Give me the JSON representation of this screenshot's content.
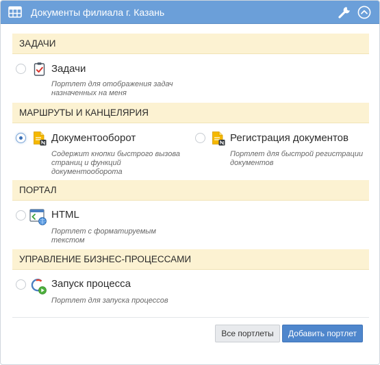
{
  "dialog": {
    "title": "Документы филиала г. Казань"
  },
  "sections": [
    {
      "title": "ЗАДАЧИ",
      "portlets": [
        {
          "name": "Задачи",
          "description": "Портлет для отображения задач назначенных на меня",
          "icon": "task-clipboard-icon",
          "selected": false
        }
      ]
    },
    {
      "title": "МАРШРУТЫ И КАНЦЕЛЯРИЯ",
      "portlets": [
        {
          "name": "Документооборот",
          "description": "Содержит кнопки быстрого вызова страниц и функций документооборота",
          "icon": "document-flow-icon",
          "selected": true
        },
        {
          "name": "Регистрация документов",
          "description": "Портлет для быстрой регистрации документов",
          "icon": "document-registration-icon",
          "selected": false
        }
      ]
    },
    {
      "title": "ПОРТАЛ",
      "portlets": [
        {
          "name": "HTML",
          "description": "Портлет с форматируемым текстом",
          "icon": "html-window-icon",
          "selected": false
        }
      ]
    },
    {
      "title": "УПРАВЛЕНИЕ БИЗНЕС-ПРОЦЕССАМИ",
      "portlets": [
        {
          "name": "Запуск процесса",
          "description": "Портлет для запуска процессов",
          "icon": "process-start-icon",
          "selected": false
        }
      ]
    }
  ],
  "footer": {
    "all_portlets_label": "Все портлеты",
    "add_portlet_label": "Добавить портлет"
  },
  "colors": {
    "header_bg": "#6b9fd9",
    "section_bg": "#fcf2d2",
    "primary_button": "#4e86cc"
  }
}
